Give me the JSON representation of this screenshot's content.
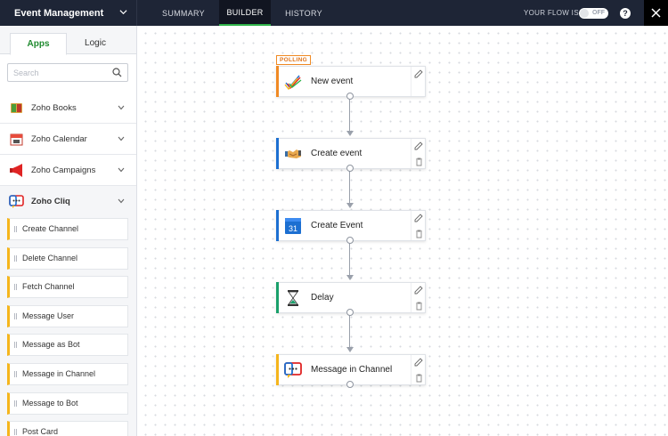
{
  "header": {
    "app_title": "Event Management",
    "tabs": [
      {
        "label": "SUMMARY"
      },
      {
        "label": "BUILDER"
      },
      {
        "label": "HISTORY"
      }
    ],
    "active_tab": "BUILDER",
    "flow_status_label": "YOUR FLOW IS",
    "flow_toggle_state": "OFF",
    "help_label": "?"
  },
  "sidebar": {
    "tabs": [
      {
        "label": "Apps"
      },
      {
        "label": "Logic"
      }
    ],
    "active_tab": "Apps",
    "search": {
      "placeholder": "Search",
      "value": ""
    },
    "apps": [
      {
        "name": "Zoho Books",
        "icon": "zoho-books-icon",
        "expanded": false
      },
      {
        "name": "Zoho Calendar",
        "icon": "zoho-calendar-icon",
        "expanded": false
      },
      {
        "name": "Zoho Campaigns",
        "icon": "zoho-campaigns-icon",
        "expanded": false
      },
      {
        "name": "Zoho Cliq",
        "icon": "zoho-cliq-icon",
        "expanded": true
      }
    ],
    "cliq_actions": [
      {
        "label": "Create Channel"
      },
      {
        "label": "Delete Channel"
      },
      {
        "label": "Fetch Channel"
      },
      {
        "label": "Message User"
      },
      {
        "label": "Message as Bot"
      },
      {
        "label": "Message in Channel"
      },
      {
        "label": "Message to Bot"
      },
      {
        "label": "Post Card"
      }
    ]
  },
  "flow": {
    "trigger_badge": "POLLING",
    "nodes": [
      {
        "label": "New event",
        "icon": "checkmark-icon",
        "accent": "#f08a24"
      },
      {
        "label": "Create event",
        "icon": "handshake-icon",
        "accent": "#1c6fd1"
      },
      {
        "label": "Create Event",
        "icon": "google-calendar-icon",
        "accent": "#1c6fd1"
      },
      {
        "label": "Delay",
        "icon": "hourglass-icon",
        "accent": "#1aa06b"
      },
      {
        "label": "Message in Channel",
        "icon": "zoho-cliq-icon",
        "accent": "#f5b51c"
      }
    ]
  },
  "colors": {
    "topbar": "#1e2536",
    "active_tab_underline": "#2fb34a",
    "apps_tab_text": "#1f8a2f",
    "cliq_action_accent": "#f5b51c"
  }
}
